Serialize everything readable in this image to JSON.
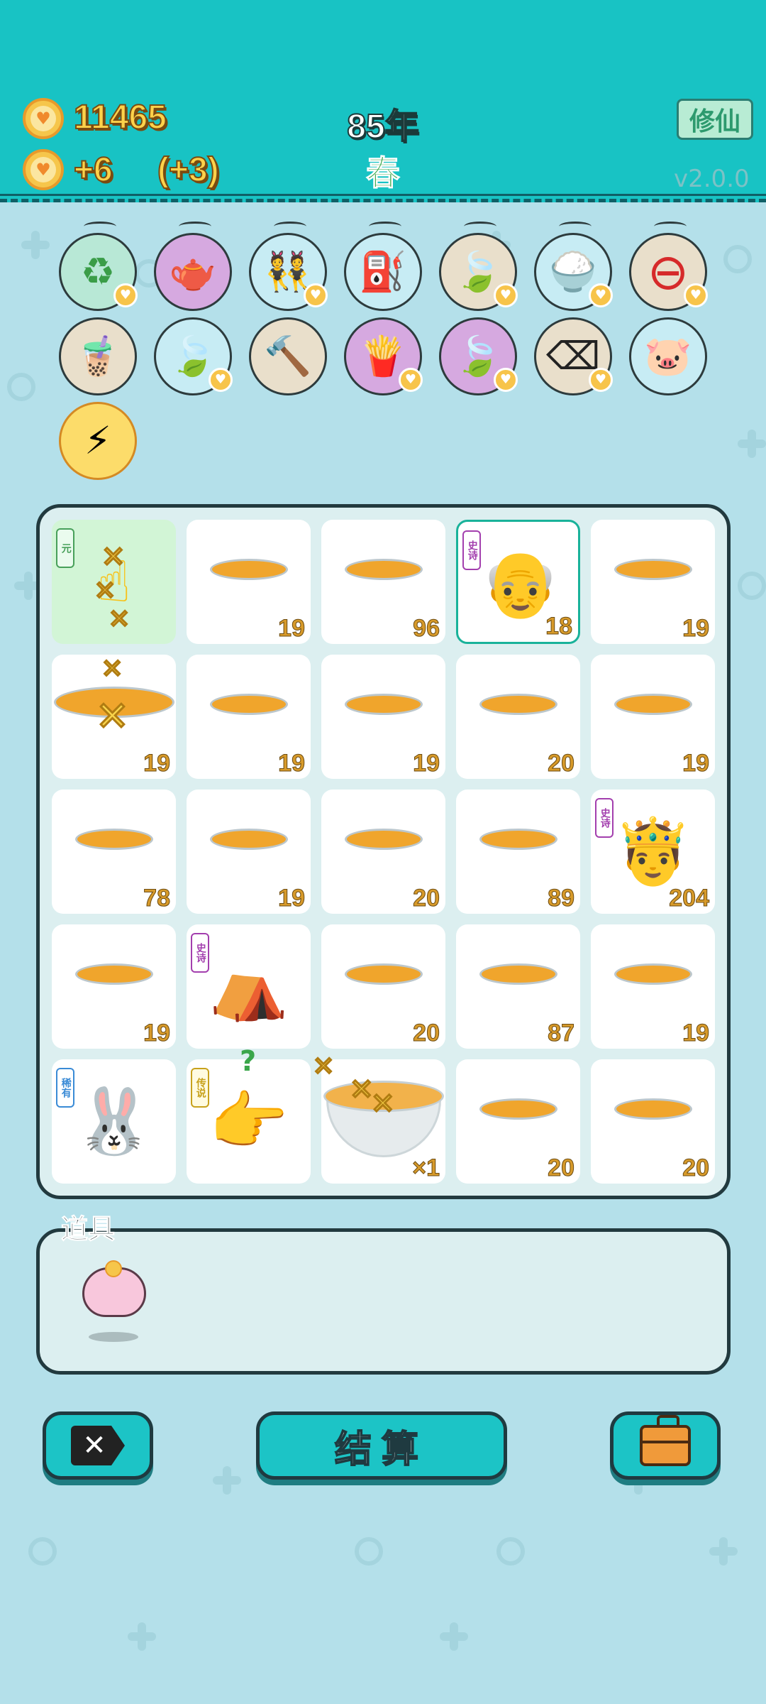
{
  "header": {
    "coins": "11465",
    "income": "+6",
    "bonus": "(+3)",
    "year": "85年",
    "season": "春",
    "mode_button": "修仙",
    "version": "v2.0.0"
  },
  "items_row1": [
    {
      "icon": "recycle-icon",
      "glyph": "♻"
    },
    {
      "icon": "gravy-boat-icon",
      "glyph": "🫖"
    },
    {
      "icon": "twins-icon",
      "glyph": "👯"
    },
    {
      "icon": "pump-icon",
      "glyph": "⛽"
    },
    {
      "icon": "leaf-icon",
      "glyph": "🍃"
    },
    {
      "icon": "rice-bowl-icon",
      "glyph": "🍚"
    },
    {
      "icon": "minus-icon",
      "glyph": "⊖"
    }
  ],
  "items_row2": [
    {
      "icon": "bubble-tea-icon",
      "glyph": "🧋"
    },
    {
      "icon": "leaf-icon",
      "glyph": "🍃"
    },
    {
      "icon": "hammer-icon",
      "glyph": "🔨"
    },
    {
      "icon": "fries-icon",
      "glyph": "🍟"
    },
    {
      "icon": "leaf-icon",
      "glyph": "🍃"
    },
    {
      "icon": "delete-tag-icon",
      "glyph": "⌫"
    },
    {
      "icon": "piggy-bank-icon",
      "glyph": "🐷"
    }
  ],
  "items_row3": [
    {
      "icon": "lightning-icon",
      "glyph": "⚡"
    }
  ],
  "board": {
    "row1": [
      {
        "type": "hand-x",
        "tag": "元",
        "count": ""
      },
      {
        "type": "bowl",
        "count": "19"
      },
      {
        "type": "bowl",
        "count": "96"
      },
      {
        "type": "old-man",
        "tag": "史诗",
        "count": "18"
      },
      {
        "type": "bowl",
        "count": "19"
      }
    ],
    "row2": [
      {
        "type": "big-bowl",
        "count": "19"
      },
      {
        "type": "bowl",
        "count": "19"
      },
      {
        "type": "bowl",
        "count": "19"
      },
      {
        "type": "bowl",
        "count": "20"
      },
      {
        "type": "bowl",
        "count": "19"
      }
    ],
    "row3": [
      {
        "type": "bowl",
        "count": "78"
      },
      {
        "type": "bowl",
        "count": "19"
      },
      {
        "type": "bowl",
        "count": "20"
      },
      {
        "type": "bowl",
        "count": "89"
      },
      {
        "type": "king",
        "tag": "史诗",
        "count": "204"
      }
    ],
    "row4": [
      {
        "type": "bowl",
        "count": "19"
      },
      {
        "type": "rabbit-house",
        "tag": "史诗",
        "count": ""
      },
      {
        "type": "bowl",
        "count": "20"
      },
      {
        "type": "bowl",
        "count": "87"
      },
      {
        "type": "bowl",
        "count": "19"
      }
    ],
    "row5": [
      {
        "type": "rabbit",
        "tag": "稀有",
        "count": ""
      },
      {
        "type": "pointing-hand",
        "tag": "传说",
        "count": ""
      },
      {
        "type": "x-bowl",
        "count": "×1"
      },
      {
        "type": "bowl",
        "count": "20"
      },
      {
        "type": "bowl",
        "count": "20"
      }
    ]
  },
  "props": {
    "title": "道具"
  },
  "buttons": {
    "settle": "结算"
  },
  "colors": {
    "header_bg": "#18c3c4",
    "page_bg": "#b4e0ea",
    "gold": "#fcd24a",
    "button": "#1cc4c6"
  }
}
